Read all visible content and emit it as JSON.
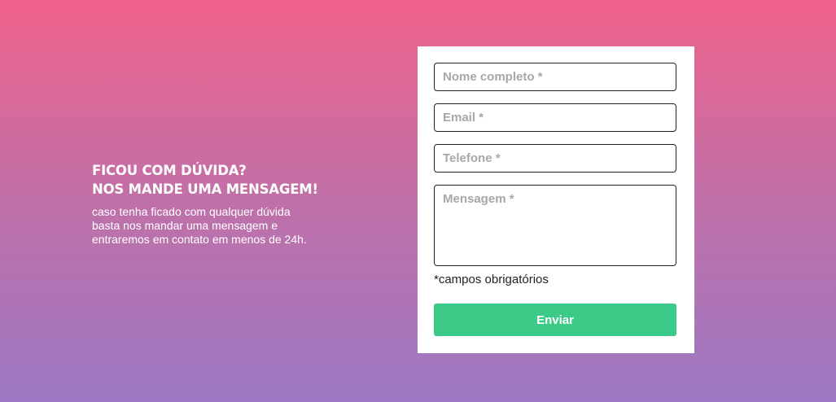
{
  "intro": {
    "heading_line1": "FICOU COM DÚVIDA?",
    "heading_line2": "NOS MANDE UMA MENSAGEM!",
    "desc_line1": "caso tenha ficado com qualquer dúvida",
    "desc_line2": "basta nos mandar uma mensagem e",
    "desc_line3": "entraremos em contato em menos de 24h."
  },
  "form": {
    "name_placeholder": "Nome completo *",
    "email_placeholder": "Email *",
    "phone_placeholder": "Telefone *",
    "message_placeholder": "Mensagem *",
    "required_note": "*campos obrigatórios",
    "submit_label": "Enviar"
  },
  "colors": {
    "gradient_top": "#f0628b",
    "gradient_bottom": "#9c78c4",
    "submit_button": "#3bca87"
  }
}
